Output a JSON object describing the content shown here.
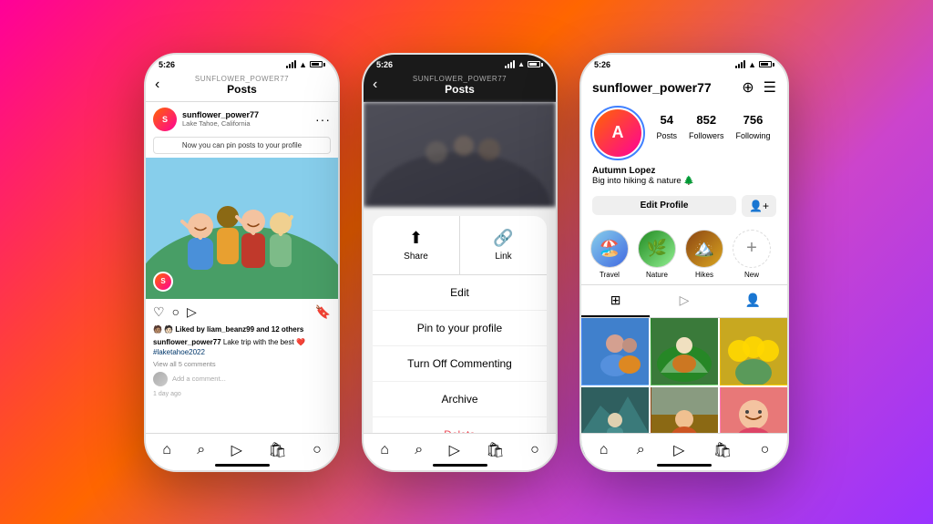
{
  "background": {
    "gradient": "linear-gradient(135deg, #ff0099 0%, #ff6600 40%, #cc44cc 70%, #9933ff 100%)"
  },
  "phone1": {
    "status_bar": {
      "time": "5:26",
      "network": "SUNFLOWER_POWER77"
    },
    "header": {
      "back_label": "‹",
      "page_name_label": "SUNFLOWER_POWER77",
      "title": "Posts"
    },
    "post": {
      "username": "sunflower_power77",
      "location": "Lake Tahoe, California",
      "pin_notice": "Now you can pin posts to your profile",
      "likes": "🧑🏽 🧑🏻 Liked by liam_beanz99 and 12 others",
      "caption_user": "sunflower_power77",
      "caption_text": " Lake trip with the best ❤️",
      "hashtag": "#laketahoe2022",
      "view_comments": "View all 5 comments",
      "add_comment_placeholder": "Add a comment...",
      "time_ago": "1 day ago"
    }
  },
  "phone2": {
    "status_bar": {
      "time": "5:26",
      "network": "SUNFLOWER_POWER77"
    },
    "header": {
      "back_label": "‹",
      "page_name_label": "SUNFLOWER_POWER77",
      "title": "Posts"
    },
    "context_menu": {
      "share_label": "Share",
      "link_label": "Link",
      "edit_label": "Edit",
      "pin_label": "Pin to your profile",
      "turn_off_commenting_label": "Turn Off Commenting",
      "archive_label": "Archive",
      "delete_label": "Delete"
    }
  },
  "phone3": {
    "status_bar": {
      "time": "5:26"
    },
    "username": "sunflower_power77",
    "stats": {
      "posts_count": "54",
      "posts_label": "Posts",
      "followers_count": "852",
      "followers_label": "Followers",
      "following_count": "756",
      "following_label": "Following"
    },
    "bio": {
      "name": "Autumn Lopez",
      "text": "Big into hiking & nature 🌲"
    },
    "edit_profile_label": "Edit Profile",
    "highlights": [
      {
        "label": "Travel",
        "emoji": "🏖️",
        "color": "hl-travel"
      },
      {
        "label": "Nature",
        "emoji": "🌿",
        "color": "hl-nature"
      },
      {
        "label": "Hikes",
        "emoji": "🏔️",
        "color": "hl-hikes"
      },
      {
        "label": "New",
        "emoji": "+",
        "color": "add-new"
      }
    ],
    "tabs": [
      {
        "label": "⊞",
        "active": true
      },
      {
        "label": "▷",
        "active": false
      },
      {
        "label": "👤",
        "active": false
      }
    ],
    "photos": [
      {
        "color": "photo-1",
        "emoji": "👥"
      },
      {
        "color": "photo-2",
        "emoji": "🌄"
      },
      {
        "color": "photo-3",
        "emoji": "🌻"
      },
      {
        "color": "photo-4",
        "emoji": "🏔️"
      },
      {
        "color": "photo-5",
        "emoji": "🌊"
      },
      {
        "color": "photo-6",
        "emoji": "🤳"
      }
    ],
    "bottom_nav": [
      "🏠",
      "🔍",
      "📺",
      "🛍️",
      "👤"
    ]
  }
}
